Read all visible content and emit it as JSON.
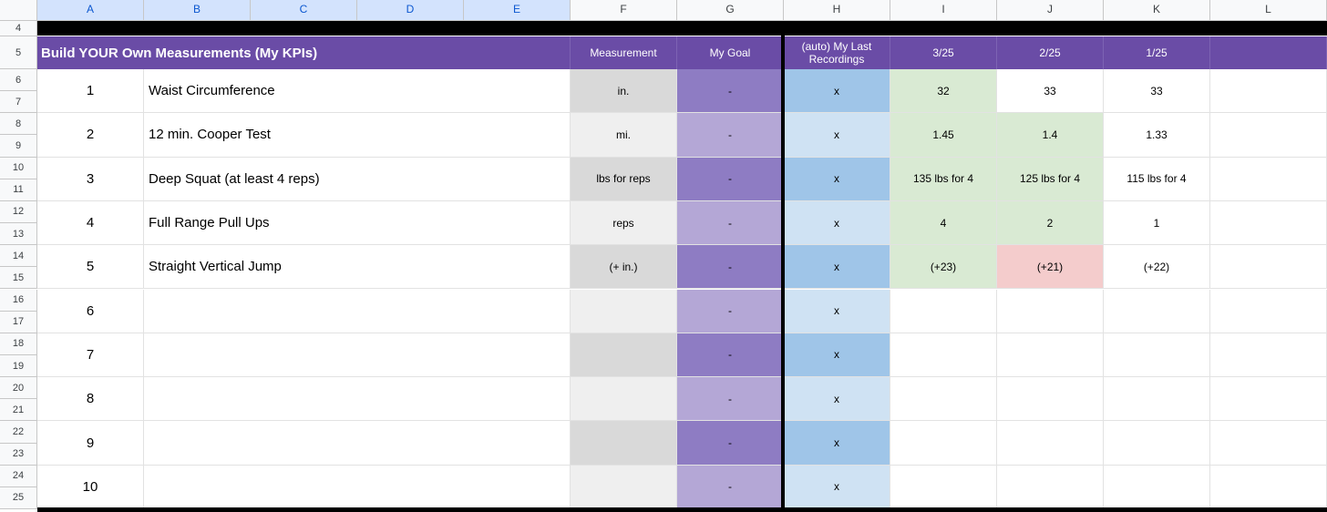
{
  "columns": [
    "A",
    "B",
    "C",
    "D",
    "E",
    "F",
    "G",
    "H",
    "I",
    "J",
    "K",
    "L"
  ],
  "selected_columns": [
    "A",
    "B",
    "C",
    "D",
    "E"
  ],
  "row_numbers": [
    "4",
    "5",
    "6",
    "7",
    "8",
    "9",
    "10",
    "11",
    "12",
    "13",
    "14",
    "15",
    "16",
    "17",
    "18",
    "19",
    "20",
    "21",
    "22",
    "23",
    "24",
    "25"
  ],
  "header": {
    "title": "Build YOUR Own Measurements (My KPIs)",
    "measurement": "Measurement",
    "goal": "My Goal",
    "last": "(auto) My Last Recordings",
    "dates": [
      "3/25",
      "2/25",
      "1/25"
    ]
  },
  "rows": [
    {
      "num": "1",
      "name": "Waist Circumference",
      "unit": "in.",
      "goal": "-",
      "last": "x",
      "values": [
        "32",
        "33",
        "33"
      ],
      "tones": [
        "green",
        "white",
        "white"
      ]
    },
    {
      "num": "2",
      "name": "12 min. Cooper Test",
      "unit": "mi.",
      "goal": "-",
      "last": "x",
      "values": [
        "1.45",
        "1.4",
        "1.33"
      ],
      "tones": [
        "green",
        "green",
        "white"
      ]
    },
    {
      "num": "3",
      "name": "Deep Squat (at least 4 reps)",
      "unit": "lbs for reps",
      "goal": "-",
      "last": "x",
      "values": [
        "135 lbs for 4",
        "125 lbs for 4",
        "115 lbs for 4"
      ],
      "tones": [
        "green",
        "green",
        "white"
      ]
    },
    {
      "num": "4",
      "name": "Full Range Pull Ups",
      "unit": "reps",
      "goal": "-",
      "last": "x",
      "values": [
        "4",
        "2",
        "1"
      ],
      "tones": [
        "green",
        "green",
        "white"
      ]
    },
    {
      "num": "5",
      "name": "Straight Vertical Jump",
      "unit": "(+ in.)",
      "goal": "-",
      "last": "x",
      "values": [
        "(+23)",
        "(+21)",
        "(+22)"
      ],
      "tones": [
        "green",
        "red",
        "white"
      ]
    },
    {
      "num": "6",
      "name": "",
      "unit": "",
      "goal": "-",
      "last": "x",
      "values": [
        "",
        "",
        ""
      ],
      "tones": [
        "white",
        "white",
        "white"
      ]
    },
    {
      "num": "7",
      "name": "",
      "unit": "",
      "goal": "-",
      "last": "x",
      "values": [
        "",
        "",
        ""
      ],
      "tones": [
        "white",
        "white",
        "white"
      ]
    },
    {
      "num": "8",
      "name": "",
      "unit": "",
      "goal": "-",
      "last": "x",
      "values": [
        "",
        "",
        ""
      ],
      "tones": [
        "white",
        "white",
        "white"
      ]
    },
    {
      "num": "9",
      "name": "",
      "unit": "",
      "goal": "-",
      "last": "x",
      "values": [
        "",
        "",
        ""
      ],
      "tones": [
        "white",
        "white",
        "white"
      ]
    },
    {
      "num": "10",
      "name": "",
      "unit": "",
      "goal": "-",
      "last": "x",
      "values": [
        "",
        "",
        ""
      ],
      "tones": [
        "white",
        "white",
        "white"
      ]
    }
  ],
  "colors": {
    "header_purple": "#6a4ca6",
    "unit_dark": "#d9d9d9",
    "unit_light": "#efefef",
    "goal_dark": "#8e7cc3",
    "goal_light": "#b4a7d6",
    "last_dark": "#9fc5e8",
    "last_light": "#cfe2f3",
    "green": "#d9ead3",
    "red": "#f4cccc",
    "white": "#ffffff"
  }
}
